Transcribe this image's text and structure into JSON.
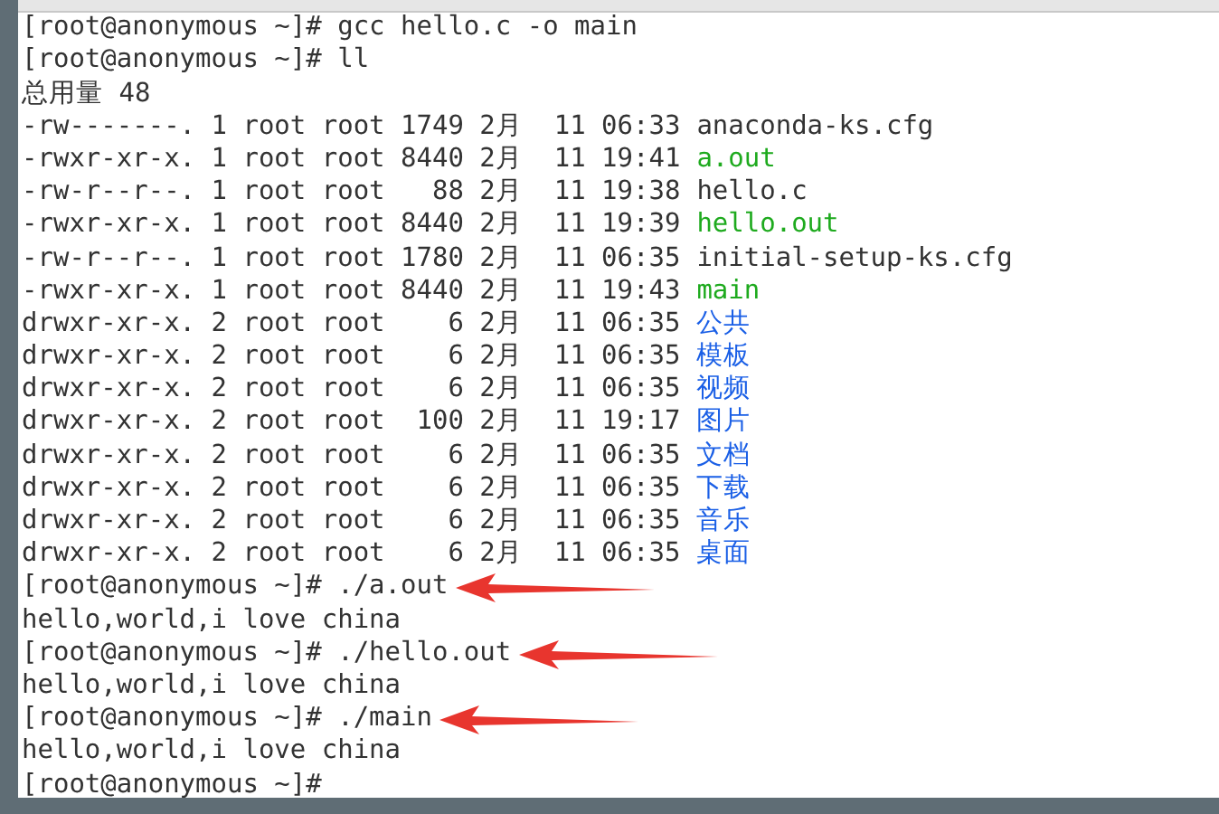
{
  "terminal": {
    "lines": [
      {
        "kind": "prompt",
        "text": "[root@anonymous ~]# gcc hello.c -o main",
        "arrow": false
      },
      {
        "kind": "prompt",
        "text": "[root@anonymous ~]# ll",
        "arrow": false
      },
      {
        "kind": "output",
        "text": "总用量 48"
      },
      {
        "kind": "entry",
        "info": "-rw-------. 1 root root 1749 2月  11 06:33",
        "name": "anaconda-ks.cfg",
        "color": "#333333"
      },
      {
        "kind": "entry",
        "info": "-rwxr-xr-x. 1 root root 8440 2月  11 19:41",
        "name": "a.out",
        "color": "#1eaa1e"
      },
      {
        "kind": "entry",
        "info": "-rw-r--r--. 1 root root   88 2月  11 19:38",
        "name": "hello.c",
        "color": "#333333"
      },
      {
        "kind": "entry",
        "info": "-rwxr-xr-x. 1 root root 8440 2月  11 19:39",
        "name": "hello.out",
        "color": "#1eaa1e"
      },
      {
        "kind": "entry",
        "info": "-rw-r--r--. 1 root root 1780 2月  11 06:35",
        "name": "initial-setup-ks.cfg",
        "color": "#333333"
      },
      {
        "kind": "entry",
        "info": "-rwxr-xr-x. 1 root root 8440 2月  11 19:43",
        "name": "main",
        "color": "#1eaa1e"
      },
      {
        "kind": "entry",
        "info": "drwxr-xr-x. 2 root root    6 2月  11 06:35",
        "name": "公共",
        "color": "#1a5fe6"
      },
      {
        "kind": "entry",
        "info": "drwxr-xr-x. 2 root root    6 2月  11 06:35",
        "name": "模板",
        "color": "#1a5fe6"
      },
      {
        "kind": "entry",
        "info": "drwxr-xr-x. 2 root root    6 2月  11 06:35",
        "name": "视频",
        "color": "#1a5fe6"
      },
      {
        "kind": "entry",
        "info": "drwxr-xr-x. 2 root root  100 2月  11 19:17",
        "name": "图片",
        "color": "#1a5fe6"
      },
      {
        "kind": "entry",
        "info": "drwxr-xr-x. 2 root root    6 2月  11 06:35",
        "name": "文档",
        "color": "#1a5fe6"
      },
      {
        "kind": "entry",
        "info": "drwxr-xr-x. 2 root root    6 2月  11 06:35",
        "name": "下载",
        "color": "#1a5fe6"
      },
      {
        "kind": "entry",
        "info": "drwxr-xr-x. 2 root root    6 2月  11 06:35",
        "name": "音乐",
        "color": "#1a5fe6"
      },
      {
        "kind": "entry",
        "info": "drwxr-xr-x. 2 root root    6 2月  11 06:35",
        "name": "桌面",
        "color": "#1a5fe6"
      },
      {
        "kind": "prompt",
        "text": "[root@anonymous ~]# ./a.out",
        "arrow": true
      },
      {
        "kind": "output",
        "text": "hello,world,i love china"
      },
      {
        "kind": "prompt",
        "text": "[root@anonymous ~]# ./hello.out",
        "arrow": true
      },
      {
        "kind": "output",
        "text": "hello,world,i love china"
      },
      {
        "kind": "prompt",
        "text": "[root@anonymous ~]# ./main",
        "arrow": true
      },
      {
        "kind": "output",
        "text": "hello,world,i love china"
      },
      {
        "kind": "prompt",
        "text": "[root@anonymous ~]#",
        "arrow": false
      }
    ]
  }
}
